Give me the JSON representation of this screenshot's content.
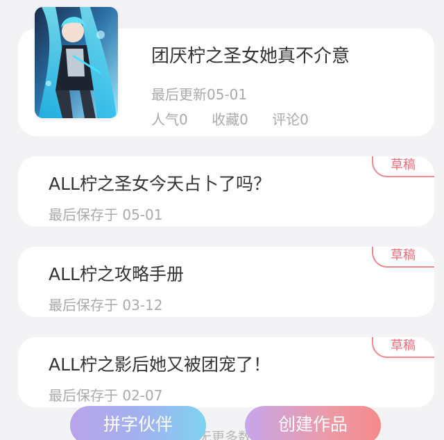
{
  "work": {
    "title": "团厌柠之圣女她真不介意",
    "updated": "最后更新05-01",
    "stats": {
      "popularity": "人气0",
      "favorites": "收藏0",
      "comments": "评论0"
    }
  },
  "drafts": [
    {
      "title": "ALL柠之圣女今天占卜了吗？",
      "saved": "最后保存于 05-01",
      "badge": "草稿"
    },
    {
      "title": "ALL柠之攻略手册",
      "saved": "最后保存于 03-12",
      "badge": "草稿"
    },
    {
      "title": "ALL柠之影后她又被团宠了！",
      "saved": "最后保存于 02-07",
      "badge": "草稿"
    }
  ],
  "footer": {
    "partner_label": "拼字伙伴",
    "create_label": "创建作品",
    "peek_text": "无更多数"
  },
  "colors": {
    "accent_pink": "#ec6b78",
    "partner_gradient_start": "#b9a3ea",
    "partner_gradient_end": "#7fd3f1",
    "create_gradient_start": "#c7a6ea",
    "create_gradient_end": "#f58a89"
  }
}
